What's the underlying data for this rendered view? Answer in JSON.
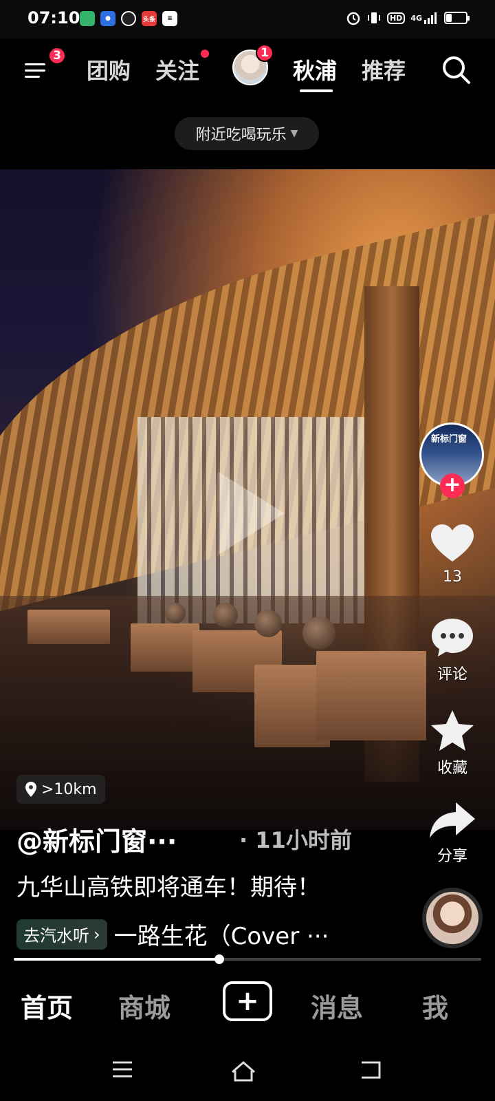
{
  "status_bar": {
    "time": "07:10",
    "network": "4G",
    "hd": "HD",
    "battery_level": 0.25,
    "app_icons": [
      "green-app-icon",
      "baidu-icon",
      "clock-app-icon",
      "toutiao-icon",
      "message-app-icon"
    ],
    "app_icon_labels": {
      "toutiao": "头条"
    }
  },
  "top_nav": {
    "menu_badge": "3",
    "tabs": [
      {
        "label": "团购",
        "active": false
      },
      {
        "label": "关注",
        "active": false,
        "dot": true
      },
      {
        "label": "秋浦",
        "active": true
      },
      {
        "label": "推荐",
        "active": false
      }
    ],
    "avatar_badge": "1"
  },
  "filter_chip": {
    "label": "附近吃喝玩乐"
  },
  "video": {
    "rail": {
      "likes": "13",
      "comment_label": "评论",
      "favorite_label": "收藏",
      "share_label": "分享",
      "creator_avatar_text": "新标门窗"
    },
    "location": ">10km",
    "author": "@新标门窗···",
    "time_ago": "· 11小时前",
    "description": "九华山高铁即将通车！期待！",
    "music_chip": "去汽水听",
    "music_title": "一路生花（Cover ···",
    "progress": 0.44
  },
  "bottom_tabs": [
    {
      "label": "首页",
      "active": true
    },
    {
      "label": "商城",
      "active": false
    },
    {
      "label": "消息",
      "active": false
    },
    {
      "label": "我",
      "active": false
    }
  ],
  "colors": {
    "accent": "#fe2c55",
    "background": "#000000"
  }
}
